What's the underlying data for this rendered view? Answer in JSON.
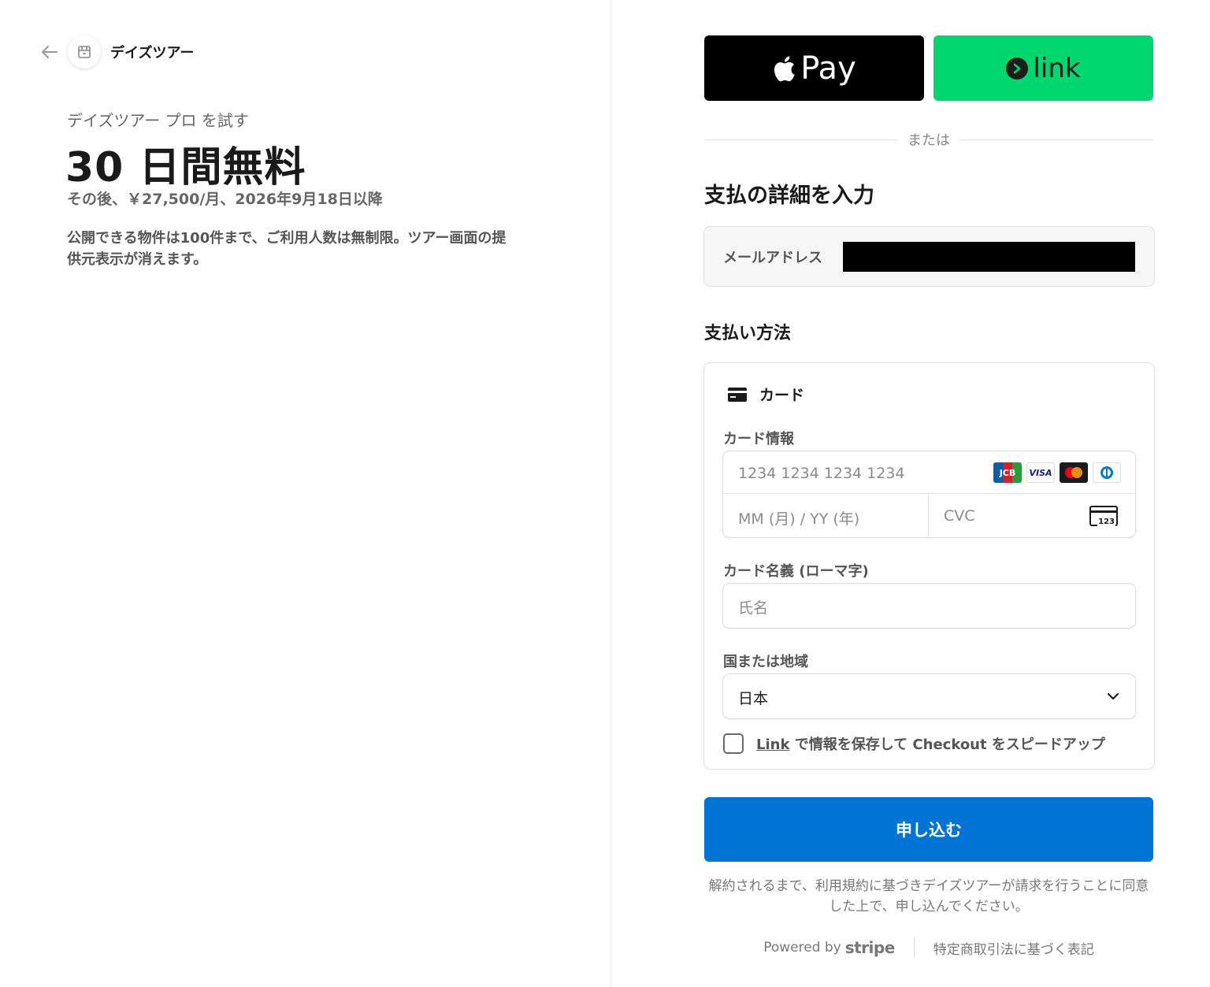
{
  "merchant": {
    "name": "デイズツアー"
  },
  "offer": {
    "trial_label": "デイズツアー プロ を試す",
    "trial_headline": "30 日間無料",
    "after_trial": "その後、￥27,500/月、2026年9月18日以降",
    "description": "公開できる物件は100件まで、ご利用人数は無制限。ツアー画面の提供元表示が消えます。"
  },
  "express": {
    "apple_pay_label": "Pay",
    "link_label": "link",
    "or_text": "または"
  },
  "form": {
    "details_heading": "支払の詳細を入力",
    "email_label": "メールアドレス",
    "method_heading": "支払い方法",
    "card_tab_label": "カード",
    "card_info_label": "カード情報",
    "card_number_placeholder": "1234 1234 1234 1234",
    "expiry_placeholder": "MM (月) / YY (年)",
    "cvc_placeholder": "CVC",
    "cvc_icon_text": "123",
    "name_label": "カード名義 (ローマ字)",
    "name_placeholder": "氏名",
    "country_label": "国または地域",
    "country_value": "日本",
    "save_link_text": "Link",
    "save_text": " で情報を保存して Checkout をスピードアップ",
    "submit_label": "申し込む",
    "brands": [
      "JCB",
      "VISA",
      "Mastercard",
      "Diners"
    ]
  },
  "legal": {
    "terms": "解約されるまで、利用規約に基づきデイズツアーが請求を行うことに同意した上で、申し込んでください。",
    "powered_by": "Powered by",
    "stripe": "stripe",
    "commerce_law": "特定商取引法に基づく表記"
  },
  "colors": {
    "submit": "#0074d4",
    "link_green": "#00d66f",
    "apple_black": "#000000"
  }
}
